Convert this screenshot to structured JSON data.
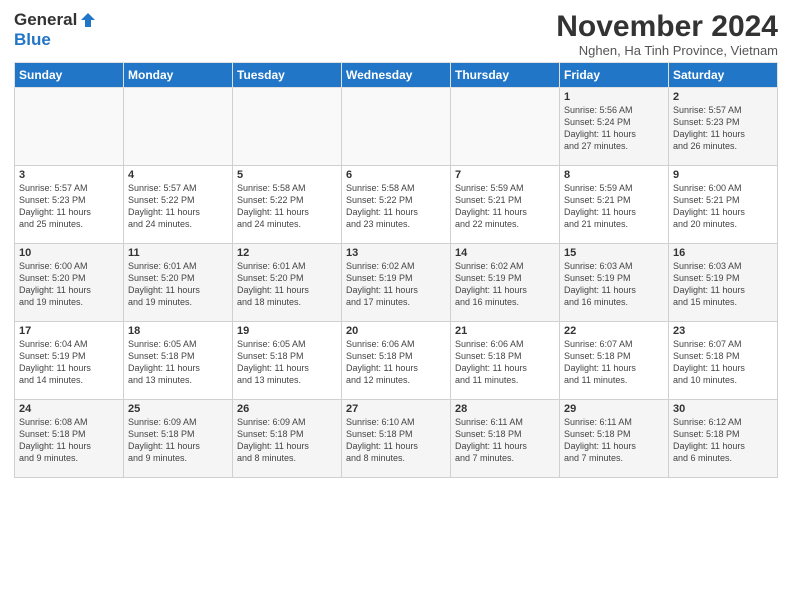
{
  "logo": {
    "general": "General",
    "blue": "Blue"
  },
  "title": "November 2024",
  "location": "Nghen, Ha Tinh Province, Vietnam",
  "days_of_week": [
    "Sunday",
    "Monday",
    "Tuesday",
    "Wednesday",
    "Thursday",
    "Friday",
    "Saturday"
  ],
  "weeks": [
    [
      {
        "num": "",
        "info": ""
      },
      {
        "num": "",
        "info": ""
      },
      {
        "num": "",
        "info": ""
      },
      {
        "num": "",
        "info": ""
      },
      {
        "num": "",
        "info": ""
      },
      {
        "num": "1",
        "info": "Sunrise: 5:56 AM\nSunset: 5:24 PM\nDaylight: 11 hours\nand 27 minutes."
      },
      {
        "num": "2",
        "info": "Sunrise: 5:57 AM\nSunset: 5:23 PM\nDaylight: 11 hours\nand 26 minutes."
      }
    ],
    [
      {
        "num": "3",
        "info": "Sunrise: 5:57 AM\nSunset: 5:23 PM\nDaylight: 11 hours\nand 25 minutes."
      },
      {
        "num": "4",
        "info": "Sunrise: 5:57 AM\nSunset: 5:22 PM\nDaylight: 11 hours\nand 24 minutes."
      },
      {
        "num": "5",
        "info": "Sunrise: 5:58 AM\nSunset: 5:22 PM\nDaylight: 11 hours\nand 24 minutes."
      },
      {
        "num": "6",
        "info": "Sunrise: 5:58 AM\nSunset: 5:22 PM\nDaylight: 11 hours\nand 23 minutes."
      },
      {
        "num": "7",
        "info": "Sunrise: 5:59 AM\nSunset: 5:21 PM\nDaylight: 11 hours\nand 22 minutes."
      },
      {
        "num": "8",
        "info": "Sunrise: 5:59 AM\nSunset: 5:21 PM\nDaylight: 11 hours\nand 21 minutes."
      },
      {
        "num": "9",
        "info": "Sunrise: 6:00 AM\nSunset: 5:21 PM\nDaylight: 11 hours\nand 20 minutes."
      }
    ],
    [
      {
        "num": "10",
        "info": "Sunrise: 6:00 AM\nSunset: 5:20 PM\nDaylight: 11 hours\nand 19 minutes."
      },
      {
        "num": "11",
        "info": "Sunrise: 6:01 AM\nSunset: 5:20 PM\nDaylight: 11 hours\nand 19 minutes."
      },
      {
        "num": "12",
        "info": "Sunrise: 6:01 AM\nSunset: 5:20 PM\nDaylight: 11 hours\nand 18 minutes."
      },
      {
        "num": "13",
        "info": "Sunrise: 6:02 AM\nSunset: 5:19 PM\nDaylight: 11 hours\nand 17 minutes."
      },
      {
        "num": "14",
        "info": "Sunrise: 6:02 AM\nSunset: 5:19 PM\nDaylight: 11 hours\nand 16 minutes."
      },
      {
        "num": "15",
        "info": "Sunrise: 6:03 AM\nSunset: 5:19 PM\nDaylight: 11 hours\nand 16 minutes."
      },
      {
        "num": "16",
        "info": "Sunrise: 6:03 AM\nSunset: 5:19 PM\nDaylight: 11 hours\nand 15 minutes."
      }
    ],
    [
      {
        "num": "17",
        "info": "Sunrise: 6:04 AM\nSunset: 5:19 PM\nDaylight: 11 hours\nand 14 minutes."
      },
      {
        "num": "18",
        "info": "Sunrise: 6:05 AM\nSunset: 5:18 PM\nDaylight: 11 hours\nand 13 minutes."
      },
      {
        "num": "19",
        "info": "Sunrise: 6:05 AM\nSunset: 5:18 PM\nDaylight: 11 hours\nand 13 minutes."
      },
      {
        "num": "20",
        "info": "Sunrise: 6:06 AM\nSunset: 5:18 PM\nDaylight: 11 hours\nand 12 minutes."
      },
      {
        "num": "21",
        "info": "Sunrise: 6:06 AM\nSunset: 5:18 PM\nDaylight: 11 hours\nand 11 minutes."
      },
      {
        "num": "22",
        "info": "Sunrise: 6:07 AM\nSunset: 5:18 PM\nDaylight: 11 hours\nand 11 minutes."
      },
      {
        "num": "23",
        "info": "Sunrise: 6:07 AM\nSunset: 5:18 PM\nDaylight: 11 hours\nand 10 minutes."
      }
    ],
    [
      {
        "num": "24",
        "info": "Sunrise: 6:08 AM\nSunset: 5:18 PM\nDaylight: 11 hours\nand 9 minutes."
      },
      {
        "num": "25",
        "info": "Sunrise: 6:09 AM\nSunset: 5:18 PM\nDaylight: 11 hours\nand 9 minutes."
      },
      {
        "num": "26",
        "info": "Sunrise: 6:09 AM\nSunset: 5:18 PM\nDaylight: 11 hours\nand 8 minutes."
      },
      {
        "num": "27",
        "info": "Sunrise: 6:10 AM\nSunset: 5:18 PM\nDaylight: 11 hours\nand 8 minutes."
      },
      {
        "num": "28",
        "info": "Sunrise: 6:11 AM\nSunset: 5:18 PM\nDaylight: 11 hours\nand 7 minutes."
      },
      {
        "num": "29",
        "info": "Sunrise: 6:11 AM\nSunset: 5:18 PM\nDaylight: 11 hours\nand 7 minutes."
      },
      {
        "num": "30",
        "info": "Sunrise: 6:12 AM\nSunset: 5:18 PM\nDaylight: 11 hours\nand 6 minutes."
      }
    ]
  ]
}
